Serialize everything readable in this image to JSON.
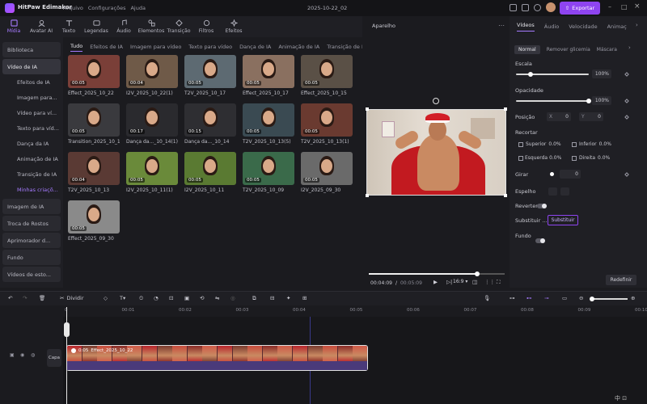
{
  "titlebar": {
    "app_name": "HitPaw Edimakor",
    "menu": [
      "Arquivo",
      "Configurações",
      "Ajuda"
    ],
    "project_name": "2025-10-22_02",
    "export_label": "Exportar"
  },
  "toolbar": {
    "tools": [
      {
        "label": "Mídia",
        "icon": "media-icon",
        "active": true
      },
      {
        "label": "Avatar AI",
        "icon": "avatar-icon",
        "active": false
      },
      {
        "label": "Texto",
        "icon": "text-icon",
        "active": false
      },
      {
        "label": "Legendas",
        "icon": "subtitles-icon",
        "active": false
      },
      {
        "label": "Áudio",
        "icon": "audio-icon",
        "active": false
      },
      {
        "label": "Elementos",
        "icon": "elements-icon",
        "active": false
      },
      {
        "label": "Transição",
        "icon": "transition-icon",
        "active": false
      },
      {
        "label": "Filtros",
        "icon": "filters-icon",
        "active": false
      },
      {
        "label": "Efeitos",
        "icon": "effects-icon",
        "active": false
      }
    ]
  },
  "sidebar": {
    "items": [
      {
        "label": "Biblioteca",
        "kind": "group"
      },
      {
        "label": "Vídeo de IA",
        "kind": "group-selected"
      },
      {
        "label": "Efeitos de IA",
        "kind": "sub"
      },
      {
        "label": "Imagem para...",
        "kind": "sub"
      },
      {
        "label": "Vídeo para ví...",
        "kind": "sub"
      },
      {
        "label": "Texto para víd...",
        "kind": "sub"
      },
      {
        "label": "Dança da IA",
        "kind": "sub"
      },
      {
        "label": "Animação de IA",
        "kind": "sub"
      },
      {
        "label": "Transição de IA",
        "kind": "sub"
      },
      {
        "label": "Minhas criaçõ...",
        "kind": "sub-selected"
      },
      {
        "label": "Imagem de IA",
        "kind": "group"
      },
      {
        "label": "Troca de Rostos",
        "kind": "group"
      },
      {
        "label": "Aprimorador d...",
        "kind": "group"
      },
      {
        "label": "Fundo",
        "kind": "group"
      },
      {
        "label": "Vídeos de esto...",
        "kind": "group"
      }
    ]
  },
  "media_tabs": [
    "Tudo",
    "Efeitos de IA",
    "Imagem para vídeo",
    "Texto para vídeo",
    "Dança de IA",
    "Animação de IA",
    "Transição de IA"
  ],
  "media_items": [
    {
      "label": "Effect_2025_10_22",
      "duration": "00:05",
      "bg": "#7a3f38"
    },
    {
      "label": "I2V_2025_10_22(1)",
      "duration": "00:04",
      "bg": "#6f5a48"
    },
    {
      "label": "T2V_2025_10_17",
      "duration": "00:05",
      "bg": "#5d6a72"
    },
    {
      "label": "Effect_2025_10_17",
      "duration": "00:05",
      "bg": "#8a7060"
    },
    {
      "label": "Effect_2025_10_15",
      "duration": "00:05",
      "bg": "#5a5046"
    },
    {
      "label": "Transition_2025_10_14",
      "duration": "00:05",
      "bg": "#3a3a3e"
    },
    {
      "label": "Dança da..._10_14(1)",
      "duration": "00:17",
      "bg": "#2a2a2e"
    },
    {
      "label": "Dança da..._10_14",
      "duration": "00:15",
      "bg": "#2e2e32"
    },
    {
      "label": "T2V_2025_10_13(5)",
      "duration": "00:05",
      "bg": "#3a4a52"
    },
    {
      "label": "T2V_2025_10_13(1)",
      "duration": "00:05",
      "bg": "#6a3a30"
    },
    {
      "label": "T2V_2025_10_13",
      "duration": "00:04",
      "bg": "#5a3a34"
    },
    {
      "label": "I2V_2025_10_11(1)",
      "duration": "00:05",
      "bg": "#6a8a3a"
    },
    {
      "label": "I2V_2025_10_11",
      "duration": "00:05",
      "bg": "#5a7a32"
    },
    {
      "label": "T2V_2025_10_09",
      "duration": "00:05",
      "bg": "#3a6a4a"
    },
    {
      "label": "I2V_2025_09_30",
      "duration": "00:05",
      "bg": "#6a6a6a"
    },
    {
      "label": "Effect_2025_09_30",
      "duration": "00:05",
      "bg": "#8a8a8a"
    }
  ],
  "preview": {
    "title": "Aparelho",
    "current_time": "00:04:09",
    "total_time": "00:05:09",
    "progress": 0.8,
    "aspect": "16:9"
  },
  "properties": {
    "tabs": [
      "Vídeos",
      "Áudio",
      "Velocidade",
      "Animaç"
    ],
    "subtabs": [
      "Normal",
      "Remover glicemia",
      "Máscara"
    ],
    "scale_label": "Escala",
    "scale_value": "100%",
    "scale_level": 0.2,
    "opacity_label": "Opacidade",
    "opacity_value": "100%",
    "opacity_level": 1.0,
    "position_label": "Posição",
    "pos_x_label": "X",
    "pos_x": "0",
    "pos_y_label": "Y",
    "pos_y": "0",
    "crop_label": "Recortar",
    "crop_top_label": "Superior",
    "crop_top": "0.0%",
    "crop_bottom_label": "Inferior",
    "crop_bottom": "0.0%",
    "crop_left_label": "Esquerda",
    "crop_left": "0.0%",
    "crop_right_label": "Direita",
    "crop_right": "0.0%",
    "rotate_label": "Girar",
    "rotate_value": "0",
    "mirror_label": "Espelho",
    "reverse_label": "Reverter",
    "replace_label": "Substituir ...",
    "replace_button": "Substituir",
    "background_label": "Fundo",
    "reset_button": "Redefinir"
  },
  "timeline": {
    "split_label": "Dividir",
    "ruler_ticks": [
      "0",
      "00:01",
      "00:02",
      "00:03",
      "00:04",
      "00:05",
      "00:06",
      "00:07",
      "00:08",
      "00:09",
      "00:10"
    ],
    "clip_duration": "0:05",
    "clip_label": "Effect_2025_10_22",
    "track_label": "Capa"
  },
  "colors": {
    "accent": "#8e44f0",
    "accent_text": "#a67bff",
    "bg": "#1b1b1f",
    "panel": "#1f1f24"
  }
}
